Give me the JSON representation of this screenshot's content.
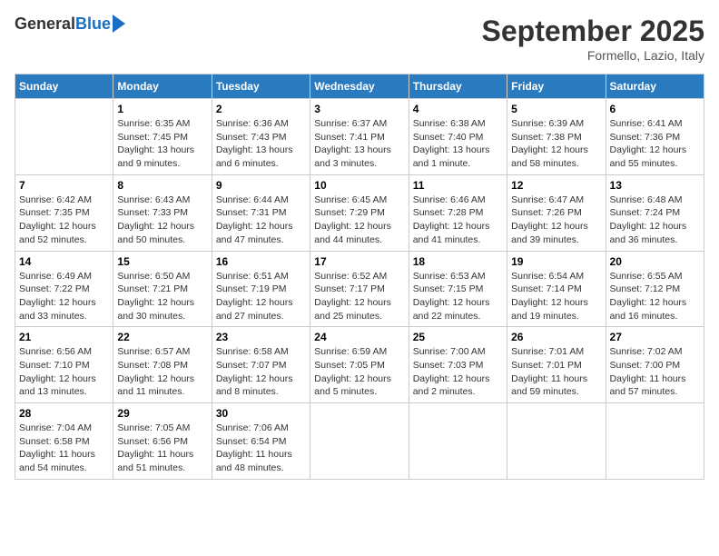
{
  "header": {
    "logo_general": "General",
    "logo_blue": "Blue",
    "month_title": "September 2025",
    "location": "Formello, Lazio, Italy"
  },
  "days_of_week": [
    "Sunday",
    "Monday",
    "Tuesday",
    "Wednesday",
    "Thursday",
    "Friday",
    "Saturday"
  ],
  "weeks": [
    [
      {
        "day": "",
        "info": ""
      },
      {
        "day": "1",
        "info": "Sunrise: 6:35 AM\nSunset: 7:45 PM\nDaylight: 13 hours\nand 9 minutes."
      },
      {
        "day": "2",
        "info": "Sunrise: 6:36 AM\nSunset: 7:43 PM\nDaylight: 13 hours\nand 6 minutes."
      },
      {
        "day": "3",
        "info": "Sunrise: 6:37 AM\nSunset: 7:41 PM\nDaylight: 13 hours\nand 3 minutes."
      },
      {
        "day": "4",
        "info": "Sunrise: 6:38 AM\nSunset: 7:40 PM\nDaylight: 13 hours\nand 1 minute."
      },
      {
        "day": "5",
        "info": "Sunrise: 6:39 AM\nSunset: 7:38 PM\nDaylight: 12 hours\nand 58 minutes."
      },
      {
        "day": "6",
        "info": "Sunrise: 6:41 AM\nSunset: 7:36 PM\nDaylight: 12 hours\nand 55 minutes."
      }
    ],
    [
      {
        "day": "7",
        "info": "Sunrise: 6:42 AM\nSunset: 7:35 PM\nDaylight: 12 hours\nand 52 minutes."
      },
      {
        "day": "8",
        "info": "Sunrise: 6:43 AM\nSunset: 7:33 PM\nDaylight: 12 hours\nand 50 minutes."
      },
      {
        "day": "9",
        "info": "Sunrise: 6:44 AM\nSunset: 7:31 PM\nDaylight: 12 hours\nand 47 minutes."
      },
      {
        "day": "10",
        "info": "Sunrise: 6:45 AM\nSunset: 7:29 PM\nDaylight: 12 hours\nand 44 minutes."
      },
      {
        "day": "11",
        "info": "Sunrise: 6:46 AM\nSunset: 7:28 PM\nDaylight: 12 hours\nand 41 minutes."
      },
      {
        "day": "12",
        "info": "Sunrise: 6:47 AM\nSunset: 7:26 PM\nDaylight: 12 hours\nand 39 minutes."
      },
      {
        "day": "13",
        "info": "Sunrise: 6:48 AM\nSunset: 7:24 PM\nDaylight: 12 hours\nand 36 minutes."
      }
    ],
    [
      {
        "day": "14",
        "info": "Sunrise: 6:49 AM\nSunset: 7:22 PM\nDaylight: 12 hours\nand 33 minutes."
      },
      {
        "day": "15",
        "info": "Sunrise: 6:50 AM\nSunset: 7:21 PM\nDaylight: 12 hours\nand 30 minutes."
      },
      {
        "day": "16",
        "info": "Sunrise: 6:51 AM\nSunset: 7:19 PM\nDaylight: 12 hours\nand 27 minutes."
      },
      {
        "day": "17",
        "info": "Sunrise: 6:52 AM\nSunset: 7:17 PM\nDaylight: 12 hours\nand 25 minutes."
      },
      {
        "day": "18",
        "info": "Sunrise: 6:53 AM\nSunset: 7:15 PM\nDaylight: 12 hours\nand 22 minutes."
      },
      {
        "day": "19",
        "info": "Sunrise: 6:54 AM\nSunset: 7:14 PM\nDaylight: 12 hours\nand 19 minutes."
      },
      {
        "day": "20",
        "info": "Sunrise: 6:55 AM\nSunset: 7:12 PM\nDaylight: 12 hours\nand 16 minutes."
      }
    ],
    [
      {
        "day": "21",
        "info": "Sunrise: 6:56 AM\nSunset: 7:10 PM\nDaylight: 12 hours\nand 13 minutes."
      },
      {
        "day": "22",
        "info": "Sunrise: 6:57 AM\nSunset: 7:08 PM\nDaylight: 12 hours\nand 11 minutes."
      },
      {
        "day": "23",
        "info": "Sunrise: 6:58 AM\nSunset: 7:07 PM\nDaylight: 12 hours\nand 8 minutes."
      },
      {
        "day": "24",
        "info": "Sunrise: 6:59 AM\nSunset: 7:05 PM\nDaylight: 12 hours\nand 5 minutes."
      },
      {
        "day": "25",
        "info": "Sunrise: 7:00 AM\nSunset: 7:03 PM\nDaylight: 12 hours\nand 2 minutes."
      },
      {
        "day": "26",
        "info": "Sunrise: 7:01 AM\nSunset: 7:01 PM\nDaylight: 11 hours\nand 59 minutes."
      },
      {
        "day": "27",
        "info": "Sunrise: 7:02 AM\nSunset: 7:00 PM\nDaylight: 11 hours\nand 57 minutes."
      }
    ],
    [
      {
        "day": "28",
        "info": "Sunrise: 7:04 AM\nSunset: 6:58 PM\nDaylight: 11 hours\nand 54 minutes."
      },
      {
        "day": "29",
        "info": "Sunrise: 7:05 AM\nSunset: 6:56 PM\nDaylight: 11 hours\nand 51 minutes."
      },
      {
        "day": "30",
        "info": "Sunrise: 7:06 AM\nSunset: 6:54 PM\nDaylight: 11 hours\nand 48 minutes."
      },
      {
        "day": "",
        "info": ""
      },
      {
        "day": "",
        "info": ""
      },
      {
        "day": "",
        "info": ""
      },
      {
        "day": "",
        "info": ""
      }
    ]
  ]
}
